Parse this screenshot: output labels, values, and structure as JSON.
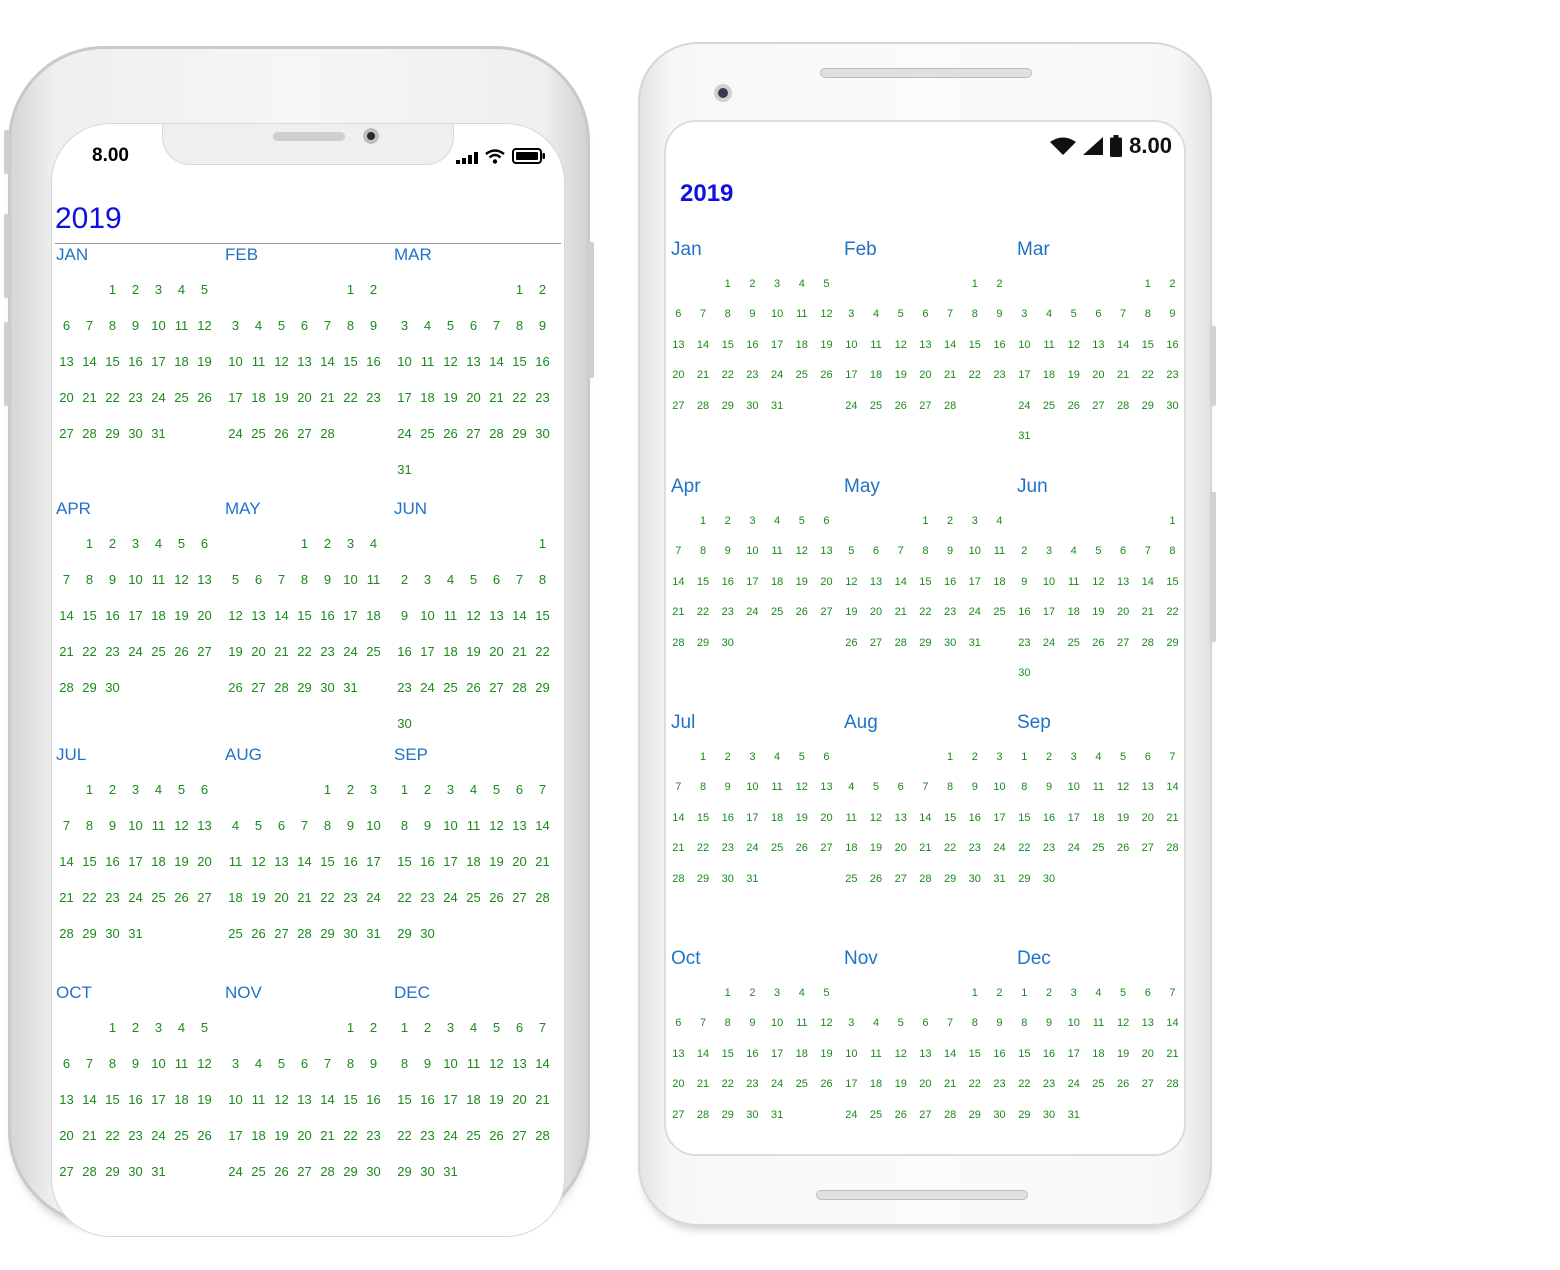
{
  "ios": {
    "status_time": "8.00",
    "year": "2019",
    "months": [
      {
        "name": "JAN",
        "offset": 2,
        "days": 31
      },
      {
        "name": "FEB",
        "offset": 5,
        "days": 28
      },
      {
        "name": "MAR",
        "offset": 5,
        "days": 31
      },
      {
        "name": "APR",
        "offset": 1,
        "days": 30
      },
      {
        "name": "MAY",
        "offset": 3,
        "days": 31
      },
      {
        "name": "JUN",
        "offset": 6,
        "days": 30
      },
      {
        "name": "JUL",
        "offset": 1,
        "days": 31
      },
      {
        "name": "AUG",
        "offset": 4,
        "days": 31
      },
      {
        "name": "SEP",
        "offset": 0,
        "days": 30
      },
      {
        "name": "OCT",
        "offset": 2,
        "days": 31
      },
      {
        "name": "NOV",
        "offset": 5,
        "days": 30
      },
      {
        "name": "DEC",
        "offset": 0,
        "days": 31
      }
    ]
  },
  "android": {
    "status_time": "8.00",
    "year": "2019",
    "months": [
      {
        "name": "Jan",
        "offset": 2,
        "days": 31
      },
      {
        "name": "Feb",
        "offset": 5,
        "days": 28
      },
      {
        "name": "Mar",
        "offset": 5,
        "days": 31
      },
      {
        "name": "Apr",
        "offset": 1,
        "days": 30
      },
      {
        "name": "May",
        "offset": 3,
        "days": 31
      },
      {
        "name": "Jun",
        "offset": 6,
        "days": 30
      },
      {
        "name": "Jul",
        "offset": 1,
        "days": 31
      },
      {
        "name": "Aug",
        "offset": 4,
        "days": 31
      },
      {
        "name": "Sep",
        "offset": 0,
        "days": 30
      },
      {
        "name": "Oct",
        "offset": 2,
        "days": 31
      },
      {
        "name": "Nov",
        "offset": 5,
        "days": 30
      },
      {
        "name": "Dec",
        "offset": 0,
        "days": 31
      }
    ]
  },
  "colors": {
    "year_text": "#1010e0",
    "month_name": "#1f73c7",
    "day_text": "#1a8a1a"
  }
}
